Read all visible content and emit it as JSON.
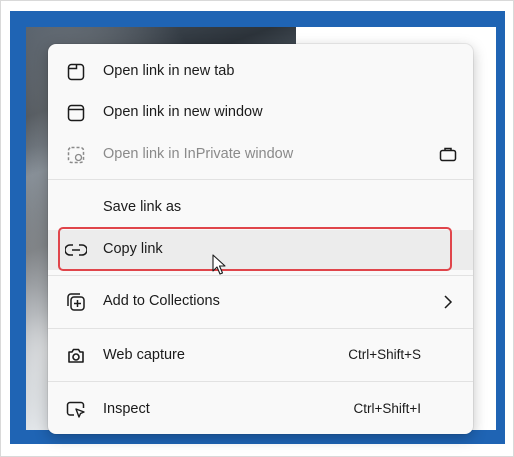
{
  "menu": {
    "items": [
      {
        "label": "Open link in new tab",
        "icon": "new-tab-icon"
      },
      {
        "label": "Open link in new window",
        "icon": "new-window-icon"
      },
      {
        "label": "Open link in InPrivate window",
        "icon": "inprivate-window-icon",
        "disabled": true,
        "trailing_icon": "briefcase-icon"
      },
      {
        "label": "Save link as"
      },
      {
        "label": "Copy link",
        "icon": "link-icon",
        "highlighted": true
      },
      {
        "label": "Add to Collections",
        "icon": "collections-icon",
        "trailing_icon": "chevron-right-icon"
      },
      {
        "label": "Web capture",
        "icon": "web-capture-icon",
        "shortcut": "Ctrl+Shift+S"
      },
      {
        "label": "Inspect",
        "icon": "inspect-icon",
        "shortcut": "Ctrl+Shift+I"
      }
    ]
  },
  "colors": {
    "frame": "#1f64b4",
    "highlight": "#e0454b",
    "menu_bg": "#f9f9f9",
    "disabled_text": "#8a8a8a"
  }
}
